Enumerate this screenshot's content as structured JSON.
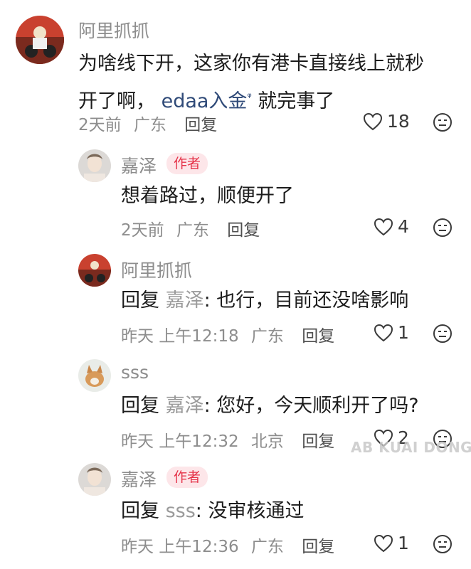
{
  "comments": [
    {
      "author": "阿里抓抓",
      "text_pre": "为啥线下开，这家你有港卡直接线上就秒开了啊，",
      "link_text": "edaa入金",
      "link_suffix": "ᵠ",
      "text_post": "就完事了",
      "time": "2天前",
      "location": "广东",
      "reply_label": "回复",
      "likes": "18"
    },
    {
      "author": "嘉泽",
      "badge": "作者",
      "text": "想着路过，顺便开了",
      "time": "2天前",
      "location": "广东",
      "reply_label": "回复",
      "likes": "4"
    },
    {
      "author": "阿里抓抓",
      "reply_prefix": "回复",
      "reply_to": "嘉泽",
      "text": "也行，目前还没啥影响",
      "time": "昨天 上午12:18",
      "location": "广东",
      "reply_label": "回复",
      "likes": "1"
    },
    {
      "author": "sss",
      "reply_prefix": "回复",
      "reply_to": "嘉泽",
      "text": "您好，今天顺利开了吗?",
      "time": "昨天 上午12:32",
      "location": "北京",
      "reply_label": "回复",
      "likes": "2"
    },
    {
      "author": "嘉泽",
      "badge": "作者",
      "reply_prefix": "回复",
      "reply_to": "sss",
      "text": "没审核通过",
      "time": "昨天 上午12:36",
      "location": "广东",
      "reply_label": "回复",
      "likes": "1"
    }
  ],
  "watermark": "AB KUAI DONG",
  "colors": {
    "author_badge": "#e5344a",
    "link": "#2f4a78",
    "meta": "#8d8d8d"
  },
  "icons": {
    "like": "heart-outline-icon",
    "dislike": "meh-face-icon"
  }
}
